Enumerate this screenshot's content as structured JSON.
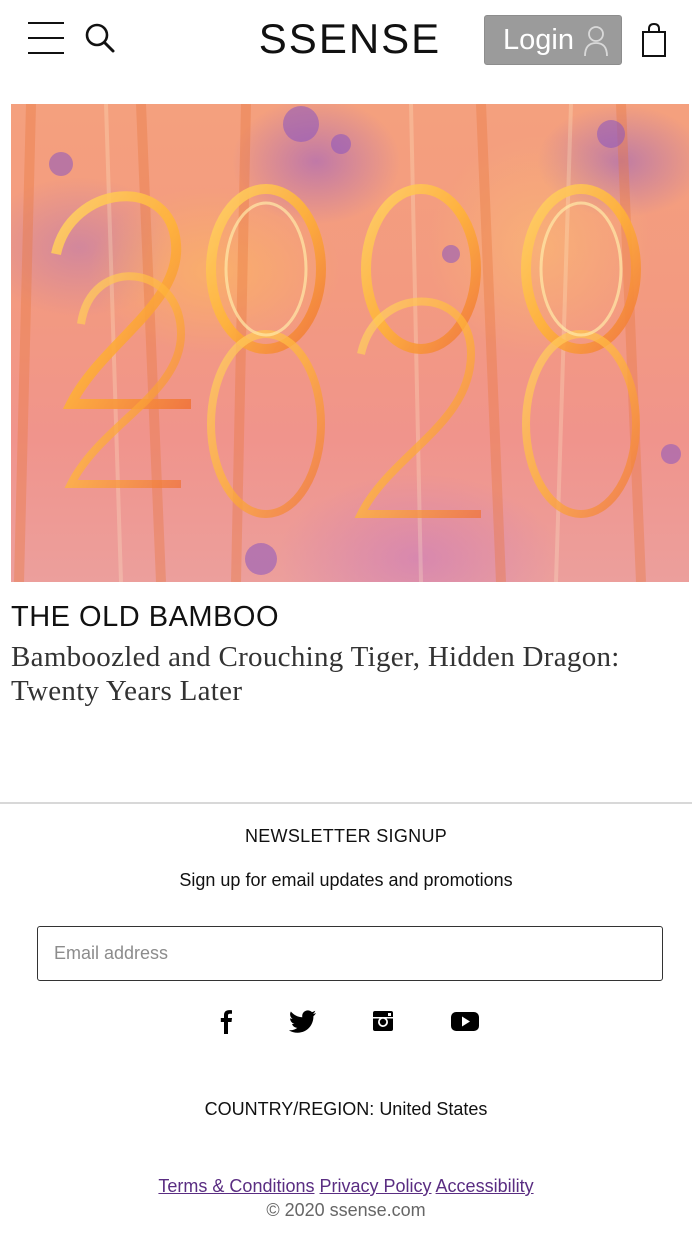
{
  "header": {
    "logo": "SSENSE",
    "login_label": "Login"
  },
  "hero": {
    "artwork_numbers": [
      "2000",
      "2020"
    ],
    "colors": {
      "base": "#f39a80",
      "gold": "#ffc04d",
      "purple": "#9a5bc7"
    }
  },
  "article": {
    "kicker": "THE OLD BAMBOO",
    "title": "Bamboozled and Crouching Tiger, Hidden Dragon: Twenty Years Later"
  },
  "footer": {
    "newsletter_title": "NEWSLETTER SIGNUP",
    "newsletter_subtitle": "Sign up for email updates and promotions",
    "email_placeholder": "Email address",
    "email_value": "",
    "social_icons": [
      "facebook-icon",
      "twitter-icon",
      "instagram-icon",
      "youtube-icon"
    ],
    "region_label": "COUNTRY/REGION:",
    "region_value": "United States",
    "links": {
      "terms": "Terms & Conditions",
      "privacy": "Privacy Policy",
      "accessibility": "Accessibility"
    },
    "copyright": "© 2020 ssense.com"
  },
  "colors": {
    "login_bg": "#9b9b9b",
    "link": "#5a2d82",
    "divider": "#d8d8d8"
  }
}
